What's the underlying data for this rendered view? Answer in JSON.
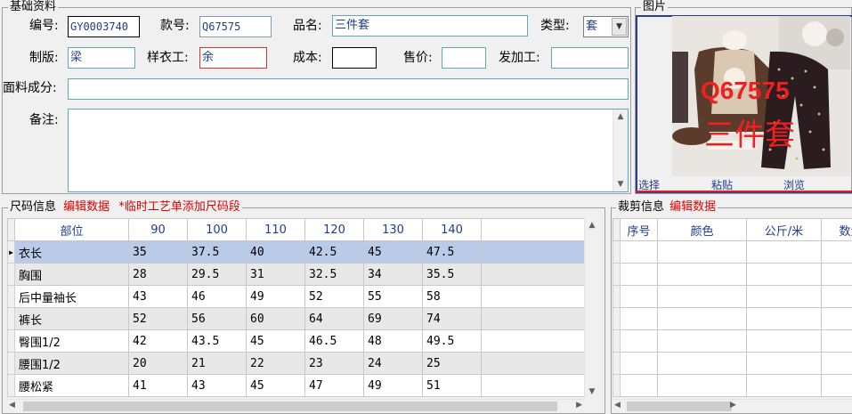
{
  "basic": {
    "title": "基础资料",
    "code_label": "编号:",
    "code_value": "GY0003740",
    "style_label": "款号:",
    "style_value": "Q67575",
    "name_label": "品名:",
    "name_value": "三件套",
    "type_label": "类型:",
    "type_value": "套",
    "pattern_label": "制版:",
    "pattern_value": "梁",
    "sample_label": "样衣工:",
    "sample_value": "余",
    "cost_label": "成本:",
    "cost_value": "",
    "price_label": "售价:",
    "price_value": "",
    "process_label": "发加工:",
    "process_value": "",
    "fabric_label": "面料成分:",
    "fabric_value": "",
    "remark_label": "备注:",
    "remark_value": ""
  },
  "image_panel": {
    "title": "图片",
    "overlay_code": "Q67575",
    "overlay_name": "三件套",
    "select_label": "选择",
    "paste_label": "粘贴",
    "browse_label": "浏览"
  },
  "size_info": {
    "title": "尺码信息",
    "edit_link": "编辑数据",
    "note": "*临时工艺单添加尺码段",
    "headers": [
      "部位",
      "90",
      "100",
      "110",
      "120",
      "130",
      "140"
    ],
    "rows": [
      [
        "衣长",
        "35",
        "37.5",
        "40",
        "42.5",
        "45",
        "47.5"
      ],
      [
        "胸围",
        "28",
        "29.5",
        "31",
        "32.5",
        "34",
        "35.5"
      ],
      [
        "后中量袖长",
        "43",
        "46",
        "49",
        "52",
        "55",
        "58"
      ],
      [
        "裤长",
        "52",
        "56",
        "60",
        "64",
        "69",
        "74"
      ],
      [
        "臀围1/2",
        "42",
        "43.5",
        "45",
        "46.5",
        "48",
        "49.5"
      ],
      [
        "腰围1/2",
        "20",
        "21",
        "22",
        "23",
        "24",
        "25"
      ],
      [
        "腰松紧",
        "41",
        "43",
        "45",
        "47",
        "49",
        "51"
      ]
    ],
    "selected_row": 0
  },
  "cut_info": {
    "title": "裁剪信息",
    "edit_link": "编辑数据",
    "headers": [
      "序号",
      "颜色",
      "公斤/米",
      "数量"
    ]
  }
}
